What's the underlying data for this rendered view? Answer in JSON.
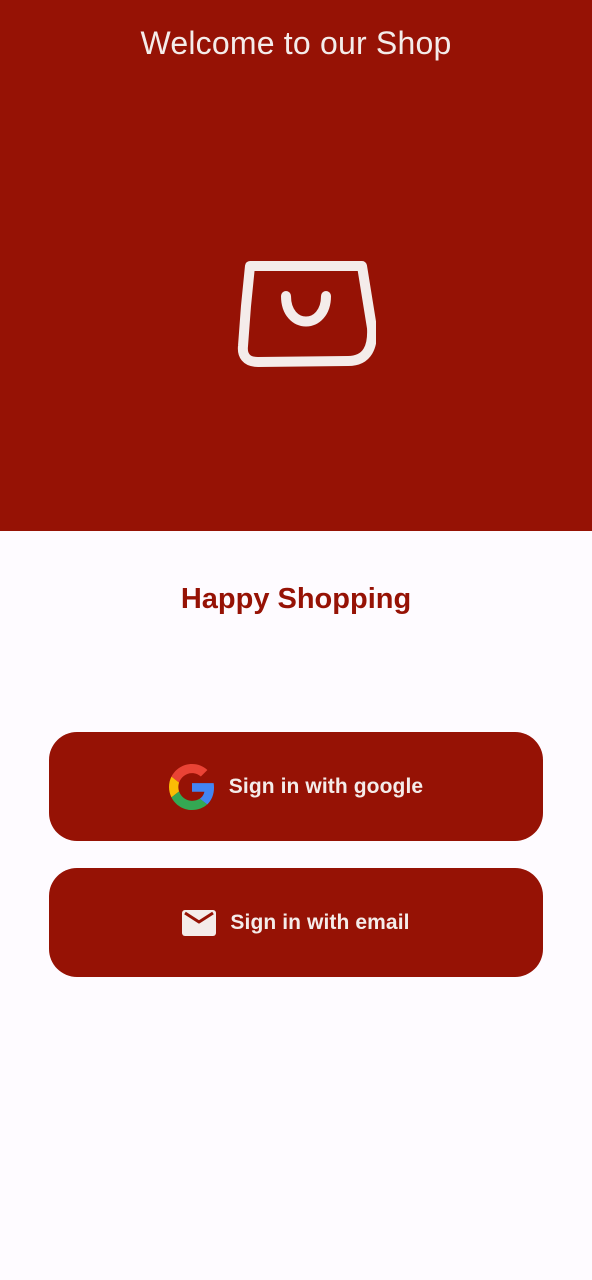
{
  "hero": {
    "title": "Welcome to our Shop",
    "icon": "shopping-bag-icon"
  },
  "tagline": "Happy Shopping",
  "buttons": {
    "google": {
      "label": "Sign in with google",
      "icon": "google-g-icon"
    },
    "email": {
      "label": "Sign in with email",
      "icon": "mail-icon"
    }
  },
  "colors": {
    "brand": "#961205",
    "background": "#fefbff",
    "on_brand": "#f4ecea"
  }
}
